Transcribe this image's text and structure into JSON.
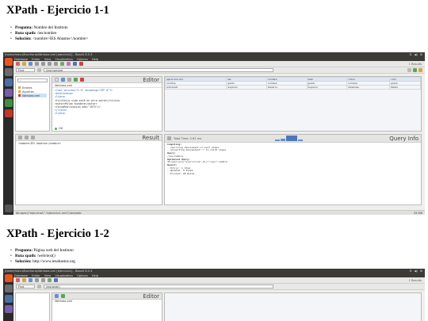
{
  "sections": [
    {
      "title": "XPath - Ejercicio 1-1",
      "bullets": [
        {
          "label": "Pregunta:",
          "value": "Nombre del Instituto"
        },
        {
          "label": "Ruta xpath:",
          "value": "/ies/nombre"
        },
        {
          "label": "Solución:",
          "value": "<nombre>IES Abastos</nombre>"
        }
      ],
      "screenshot": {
        "window_title": "/home/mavu/Escritorio/libhtxea.xml [ejercicio1] - BaseX 8.5.3",
        "menu": [
          "Database",
          "Editor",
          "View",
          "Visualization",
          "Options",
          "Help"
        ],
        "results_count": "1 Results",
        "find_label": "Find",
        "query_path": "/ies/nombre",
        "editor_title": "Editor",
        "editor_file": "libhtxea.xml",
        "code_lines": [
          "<?xml version=\"1.0\" encoding=\"UTF-8\"?>",
          "<biblioteca>",
          "  <libro>",
          "    <titulo>La vida está en otra parte</titulo>",
          "    <autor>Milan Kundera</autor>",
          "    <fechaPublicacion año=\"1973\"/>",
          "  </libro>",
          "  <libro>"
        ],
        "ok_label": "OK",
        "result_title": "Result",
        "result_text": "<nombre>IES Abastos</nombre>",
        "query_info_title": "Query Info",
        "total_time": "Total Time: 2.61 ms",
        "compiling_label": "Compiling:",
        "compiling_lines": [
          "- rewriting descendant-or-self steps",
          "- converting descendant::* to child steps"
        ],
        "query_label": "Query:",
        "query_value": "/ies/nombre",
        "optimized_label": "Optimized Query:",
        "optimized_value": "db:open-pre(\"ejercicio1\",0)/*:ies/*:nombre",
        "result_label": "Result:",
        "result_lines": [
          "- Hit(s): 1 Item",
          "- Updated: 0 Items",
          "- Printed: 28 Bytes"
        ],
        "status_text": "db:open(\"ejercicio1\",\"ejercicio1.xml\")/ies/web",
        "status_right": "33 MB",
        "tree_items": [
          "Entries",
          "Apuntes",
          "libhtxea.xml"
        ],
        "table_head": [
          "ejercicio1.xml",
          "ies",
          "nombre",
          "web",
          "ciclos",
          "ciclo"
        ],
        "table_cells": [
          "nombre",
          "grado",
          "nombre",
          "grado",
          "nombre",
          "grado",
          "Sistemas",
          "Medio",
          "Administr.",
          "Superior",
          "Desarro.",
          "Superior"
        ]
      }
    },
    {
      "title": "XPath - Ejercicio 1-2",
      "bullets": [
        {
          "label": "Pregunta:",
          "value": "Página web del Instituto"
        },
        {
          "label": "Ruta xpath:",
          "value": "/web/text()"
        },
        {
          "label": "Solución:",
          "value": "http://www.iesabastos.org"
        }
      ],
      "screenshot": {
        "window_title": "/home/mavu/Escritorio/libhtxea.xml [ejercicio1] - BaseX 8.5.3",
        "menu": [
          "Database",
          "Editor",
          "View",
          "Visualization",
          "Options",
          "Help"
        ],
        "results_count": "1 Results",
        "find_label": "Find",
        "query_path": "/ies/web()",
        "editor_title": "Editor",
        "editor_file": "libhtxea.xml"
      }
    }
  ]
}
